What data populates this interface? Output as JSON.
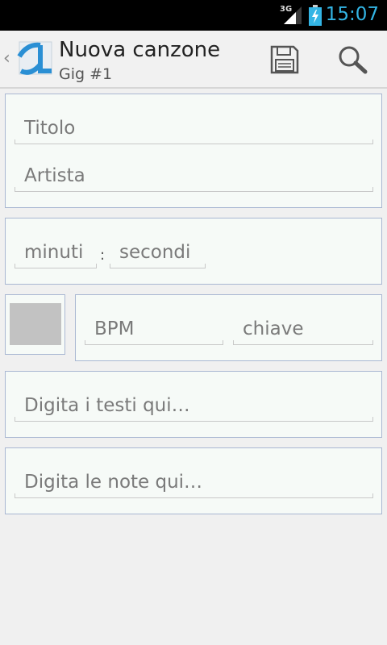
{
  "status_bar": {
    "time": "15:07",
    "network": "3G",
    "icons": [
      "signal-icon",
      "battery-charging-icon"
    ]
  },
  "action_bar": {
    "title": "Nuova canzone",
    "subtitle": "Gig #1",
    "icons": [
      "up-caret-icon",
      "app-logo-icon",
      "save-icon",
      "search-icon"
    ]
  },
  "form": {
    "title_placeholder": "Titolo",
    "artist_placeholder": "Artista",
    "minutes_placeholder": "minuti",
    "time_separator": ":",
    "seconds_placeholder": "secondi",
    "bpm_placeholder": "BPM",
    "key_placeholder": "chiave",
    "lyrics_placeholder": "Digita i testi qui…",
    "notes_placeholder": "Digita le note qui…"
  },
  "colors": {
    "status_clock": "#33b5e5",
    "card_background": "#f6faf7",
    "card_border": "#a9b7d2",
    "swatch": "#c2c2c2"
  }
}
